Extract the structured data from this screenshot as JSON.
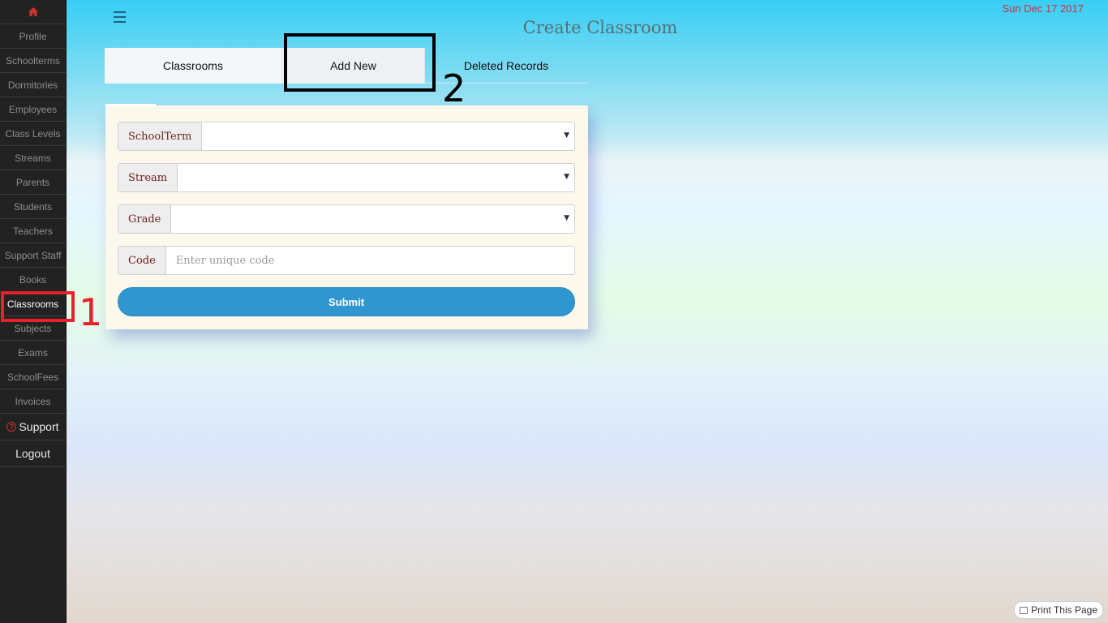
{
  "header": {
    "title": "Create Classroom",
    "date": "Sun Dec 17 2017"
  },
  "sidebar": {
    "items": [
      {
        "label": "Profile"
      },
      {
        "label": "Schoolterms"
      },
      {
        "label": "Dormitories"
      },
      {
        "label": "Employees"
      },
      {
        "label": "Class Levels"
      },
      {
        "label": "Streams"
      },
      {
        "label": "Parents"
      },
      {
        "label": "Students"
      },
      {
        "label": "Teachers"
      },
      {
        "label": "Support Staff"
      },
      {
        "label": "Books"
      },
      {
        "label": "Classrooms"
      },
      {
        "label": "Subjects"
      },
      {
        "label": "Exams"
      },
      {
        "label": "SchoolFees"
      },
      {
        "label": "Invoices"
      }
    ],
    "active": "Classrooms",
    "support": "Support",
    "logout": "Logout"
  },
  "tabs": [
    {
      "label": "Classrooms"
    },
    {
      "label": "Add New"
    },
    {
      "label": "Deleted Records"
    }
  ],
  "form": {
    "schoolterm_label": "SchoolTerm",
    "stream_label": "Stream",
    "grade_label": "Grade",
    "code_label": "Code",
    "code_placeholder": "Enter unique code",
    "submit_label": "Submit"
  },
  "annotations": {
    "one": "1",
    "two": "2"
  },
  "footer": {
    "print_label": "Print This Page"
  },
  "colors": {
    "accent": "#2f96d0",
    "date": "#c8333a",
    "annotation_1": "#e8212d",
    "annotation_2": "#000000"
  }
}
